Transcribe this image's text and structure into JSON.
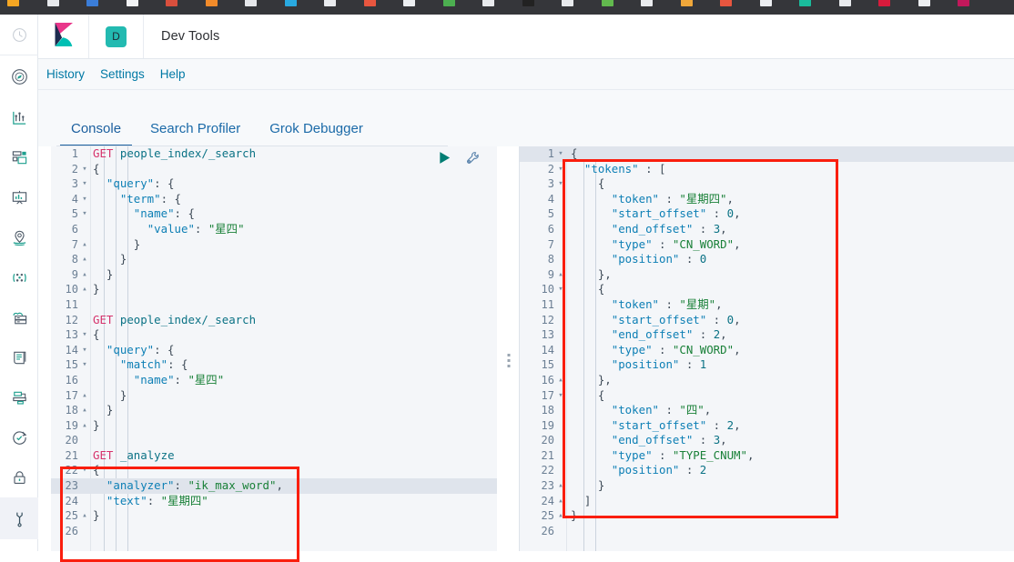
{
  "browser": {
    "bookmark_favicons": [
      "#f5a623",
      "#e8eaed",
      "#3b7dd8",
      "#f2f3f5",
      "#d94f3d",
      "#f28b2a",
      "#e5e7ea",
      "#29a9e0",
      "#e9ebee",
      "#e8563f",
      "#eceef1",
      "#4caf50",
      "#e8eaed",
      "#222222",
      "#e8eaed",
      "#62b94e",
      "#e9ebee",
      "#f0a73a",
      "#e8563f",
      "#eceef1",
      "#1abc9c",
      "#e8eaed",
      "#d81b3c",
      "#eceef1",
      "#c2185b"
    ]
  },
  "global_nav": {
    "items": [
      {
        "name": "recently-viewed",
        "icon": "clock-icon"
      },
      {
        "name": "discover",
        "icon": "compass-icon"
      },
      {
        "name": "visualize",
        "icon": "chart-icon"
      },
      {
        "name": "dashboard",
        "icon": "dashboard-icon"
      },
      {
        "name": "canvas",
        "icon": "presentation-icon"
      },
      {
        "name": "maps",
        "icon": "map-marker-icon"
      },
      {
        "name": "machine-learning",
        "icon": "ml-nodes-icon"
      },
      {
        "name": "infrastructure",
        "icon": "server-cloud-icon"
      },
      {
        "name": "logs",
        "icon": "logs-scroll-icon"
      },
      {
        "name": "apm",
        "icon": "apm-trace-icon"
      },
      {
        "name": "uptime",
        "icon": "uptime-clock-icon"
      },
      {
        "name": "security",
        "icon": "lock-icon"
      },
      {
        "name": "dev-tools",
        "icon": "wrench-icon"
      }
    ]
  },
  "header": {
    "logo": "kibana-logo",
    "space_badge": "D",
    "title": "Dev Tools"
  },
  "nav_links": [
    {
      "label": "History",
      "name": "history-link"
    },
    {
      "label": "Settings",
      "name": "settings-link"
    },
    {
      "label": "Help",
      "name": "help-link"
    }
  ],
  "tabs": [
    {
      "label": "Console",
      "active": true
    },
    {
      "label": "Search Profiler",
      "active": false
    },
    {
      "label": "Grok Debugger",
      "active": false
    }
  ],
  "editor_actions": [
    {
      "name": "send-request-button",
      "icon": "play-triangle-icon",
      "color": "#017d73"
    },
    {
      "name": "request-options-button",
      "icon": "wrench-icon",
      "color": "#5c85ad"
    }
  ],
  "colors": {
    "accent_blue": "#1b5f9e",
    "link_blue": "#0079a5",
    "teal": "#23bab1",
    "annotation_red": "#fa1e0e",
    "editor_bg": "#f4f6f9",
    "active_line": "#dfe4ec",
    "method": "#d6336c",
    "key": "#0d7fb5",
    "string": "#198038"
  },
  "request_editor": {
    "name": "console-request-editor",
    "active_line": 23,
    "lines": [
      {
        "n": 1,
        "fold": "",
        "tokens": [
          {
            "c": "t-method",
            "t": "GET"
          },
          {
            "c": "t-plain",
            "t": " "
          },
          {
            "c": "t-url",
            "t": "people_index/_search"
          }
        ]
      },
      {
        "n": 2,
        "fold": "▾",
        "tokens": [
          {
            "c": "t-punc",
            "t": "{"
          }
        ]
      },
      {
        "n": 3,
        "fold": "▾",
        "tokens": [
          {
            "c": "t-plain",
            "t": "  "
          },
          {
            "c": "t-key",
            "t": "\"query\""
          },
          {
            "c": "t-punc",
            "t": ": {"
          }
        ]
      },
      {
        "n": 4,
        "fold": "▾",
        "tokens": [
          {
            "c": "t-plain",
            "t": "    "
          },
          {
            "c": "t-key",
            "t": "\"term\""
          },
          {
            "c": "t-punc",
            "t": ": {"
          }
        ]
      },
      {
        "n": 5,
        "fold": "▾",
        "tokens": [
          {
            "c": "t-plain",
            "t": "      "
          },
          {
            "c": "t-key",
            "t": "\"name\""
          },
          {
            "c": "t-punc",
            "t": ": {"
          }
        ]
      },
      {
        "n": 6,
        "fold": "",
        "tokens": [
          {
            "c": "t-plain",
            "t": "        "
          },
          {
            "c": "t-key",
            "t": "\"value\""
          },
          {
            "c": "t-punc",
            "t": ": "
          },
          {
            "c": "t-str",
            "t": "\"星四\""
          }
        ]
      },
      {
        "n": 7,
        "fold": "▴",
        "tokens": [
          {
            "c": "t-plain",
            "t": "      "
          },
          {
            "c": "t-punc",
            "t": "}"
          }
        ]
      },
      {
        "n": 8,
        "fold": "▴",
        "tokens": [
          {
            "c": "t-plain",
            "t": "    "
          },
          {
            "c": "t-punc",
            "t": "}"
          }
        ]
      },
      {
        "n": 9,
        "fold": "▴",
        "tokens": [
          {
            "c": "t-plain",
            "t": "  "
          },
          {
            "c": "t-punc",
            "t": "}"
          }
        ]
      },
      {
        "n": 10,
        "fold": "▴",
        "tokens": [
          {
            "c": "t-punc",
            "t": "}"
          }
        ]
      },
      {
        "n": 11,
        "fold": "",
        "tokens": []
      },
      {
        "n": 12,
        "fold": "",
        "tokens": [
          {
            "c": "t-method",
            "t": "GET"
          },
          {
            "c": "t-plain",
            "t": " "
          },
          {
            "c": "t-url",
            "t": "people_index/_search"
          }
        ]
      },
      {
        "n": 13,
        "fold": "▾",
        "tokens": [
          {
            "c": "t-punc",
            "t": "{"
          }
        ]
      },
      {
        "n": 14,
        "fold": "▾",
        "tokens": [
          {
            "c": "t-plain",
            "t": "  "
          },
          {
            "c": "t-key",
            "t": "\"query\""
          },
          {
            "c": "t-punc",
            "t": ": {"
          }
        ]
      },
      {
        "n": 15,
        "fold": "▾",
        "tokens": [
          {
            "c": "t-plain",
            "t": "    "
          },
          {
            "c": "t-key",
            "t": "\"match\""
          },
          {
            "c": "t-punc",
            "t": ": {"
          }
        ]
      },
      {
        "n": 16,
        "fold": "",
        "tokens": [
          {
            "c": "t-plain",
            "t": "      "
          },
          {
            "c": "t-key",
            "t": "\"name\""
          },
          {
            "c": "t-punc",
            "t": ": "
          },
          {
            "c": "t-str",
            "t": "\"星四\""
          }
        ]
      },
      {
        "n": 17,
        "fold": "▴",
        "tokens": [
          {
            "c": "t-plain",
            "t": "    "
          },
          {
            "c": "t-punc",
            "t": "}"
          }
        ]
      },
      {
        "n": 18,
        "fold": "▴",
        "tokens": [
          {
            "c": "t-plain",
            "t": "  "
          },
          {
            "c": "t-punc",
            "t": "}"
          }
        ]
      },
      {
        "n": 19,
        "fold": "▴",
        "tokens": [
          {
            "c": "t-punc",
            "t": "}"
          }
        ]
      },
      {
        "n": 20,
        "fold": "",
        "tokens": []
      },
      {
        "n": 21,
        "fold": "",
        "tokens": [
          {
            "c": "t-method",
            "t": "GET"
          },
          {
            "c": "t-plain",
            "t": " "
          },
          {
            "c": "t-url",
            "t": "_analyze"
          }
        ]
      },
      {
        "n": 22,
        "fold": "▾",
        "tokens": [
          {
            "c": "t-punc",
            "t": "{"
          }
        ]
      },
      {
        "n": 23,
        "fold": "",
        "tokens": [
          {
            "c": "t-plain",
            "t": "  "
          },
          {
            "c": "t-key",
            "t": "\"analyzer\""
          },
          {
            "c": "t-punc",
            "t": ": "
          },
          {
            "c": "t-str",
            "t": "\"ik_max_word\""
          },
          {
            "c": "t-punc",
            "t": ","
          }
        ]
      },
      {
        "n": 24,
        "fold": "",
        "tokens": [
          {
            "c": "t-plain",
            "t": "  "
          },
          {
            "c": "t-key",
            "t": "\"text\""
          },
          {
            "c": "t-punc",
            "t": ": "
          },
          {
            "c": "t-str",
            "t": "\"星期四\""
          }
        ]
      },
      {
        "n": 25,
        "fold": "▴",
        "tokens": [
          {
            "c": "t-punc",
            "t": "}"
          }
        ]
      },
      {
        "n": 26,
        "fold": "",
        "tokens": []
      }
    ]
  },
  "response_editor": {
    "name": "console-response-editor",
    "active_line": 1,
    "lines": [
      {
        "n": 1,
        "fold": "▾",
        "tokens": [
          {
            "c": "t-punc",
            "t": "{"
          }
        ]
      },
      {
        "n": 2,
        "fold": "▾",
        "tokens": [
          {
            "c": "t-plain",
            "t": "  "
          },
          {
            "c": "t-key",
            "t": "\"tokens\""
          },
          {
            "c": "t-punc",
            "t": " : ["
          }
        ]
      },
      {
        "n": 3,
        "fold": "▾",
        "tokens": [
          {
            "c": "t-plain",
            "t": "    "
          },
          {
            "c": "t-punc",
            "t": "{"
          }
        ]
      },
      {
        "n": 4,
        "fold": "",
        "tokens": [
          {
            "c": "t-plain",
            "t": "      "
          },
          {
            "c": "t-key",
            "t": "\"token\""
          },
          {
            "c": "t-punc",
            "t": " : "
          },
          {
            "c": "t-str",
            "t": "\"星期四\""
          },
          {
            "c": "t-punc",
            "t": ","
          }
        ]
      },
      {
        "n": 5,
        "fold": "",
        "tokens": [
          {
            "c": "t-plain",
            "t": "      "
          },
          {
            "c": "t-key",
            "t": "\"start_offset\""
          },
          {
            "c": "t-punc",
            "t": " : "
          },
          {
            "c": "t-num",
            "t": "0"
          },
          {
            "c": "t-punc",
            "t": ","
          }
        ]
      },
      {
        "n": 6,
        "fold": "",
        "tokens": [
          {
            "c": "t-plain",
            "t": "      "
          },
          {
            "c": "t-key",
            "t": "\"end_offset\""
          },
          {
            "c": "t-punc",
            "t": " : "
          },
          {
            "c": "t-num",
            "t": "3"
          },
          {
            "c": "t-punc",
            "t": ","
          }
        ]
      },
      {
        "n": 7,
        "fold": "",
        "tokens": [
          {
            "c": "t-plain",
            "t": "      "
          },
          {
            "c": "t-key",
            "t": "\"type\""
          },
          {
            "c": "t-punc",
            "t": " : "
          },
          {
            "c": "t-str",
            "t": "\"CN_WORD\""
          },
          {
            "c": "t-punc",
            "t": ","
          }
        ]
      },
      {
        "n": 8,
        "fold": "",
        "tokens": [
          {
            "c": "t-plain",
            "t": "      "
          },
          {
            "c": "t-key",
            "t": "\"position\""
          },
          {
            "c": "t-punc",
            "t": " : "
          },
          {
            "c": "t-num",
            "t": "0"
          }
        ]
      },
      {
        "n": 9,
        "fold": "▴",
        "tokens": [
          {
            "c": "t-plain",
            "t": "    "
          },
          {
            "c": "t-punc",
            "t": "},"
          }
        ]
      },
      {
        "n": 10,
        "fold": "▾",
        "tokens": [
          {
            "c": "t-plain",
            "t": "    "
          },
          {
            "c": "t-punc",
            "t": "{"
          }
        ]
      },
      {
        "n": 11,
        "fold": "",
        "tokens": [
          {
            "c": "t-plain",
            "t": "      "
          },
          {
            "c": "t-key",
            "t": "\"token\""
          },
          {
            "c": "t-punc",
            "t": " : "
          },
          {
            "c": "t-str",
            "t": "\"星期\""
          },
          {
            "c": "t-punc",
            "t": ","
          }
        ]
      },
      {
        "n": 12,
        "fold": "",
        "tokens": [
          {
            "c": "t-plain",
            "t": "      "
          },
          {
            "c": "t-key",
            "t": "\"start_offset\""
          },
          {
            "c": "t-punc",
            "t": " : "
          },
          {
            "c": "t-num",
            "t": "0"
          },
          {
            "c": "t-punc",
            "t": ","
          }
        ]
      },
      {
        "n": 13,
        "fold": "",
        "tokens": [
          {
            "c": "t-plain",
            "t": "      "
          },
          {
            "c": "t-key",
            "t": "\"end_offset\""
          },
          {
            "c": "t-punc",
            "t": " : "
          },
          {
            "c": "t-num",
            "t": "2"
          },
          {
            "c": "t-punc",
            "t": ","
          }
        ]
      },
      {
        "n": 14,
        "fold": "",
        "tokens": [
          {
            "c": "t-plain",
            "t": "      "
          },
          {
            "c": "t-key",
            "t": "\"type\""
          },
          {
            "c": "t-punc",
            "t": " : "
          },
          {
            "c": "t-str",
            "t": "\"CN_WORD\""
          },
          {
            "c": "t-punc",
            "t": ","
          }
        ]
      },
      {
        "n": 15,
        "fold": "",
        "tokens": [
          {
            "c": "t-plain",
            "t": "      "
          },
          {
            "c": "t-key",
            "t": "\"position\""
          },
          {
            "c": "t-punc",
            "t": " : "
          },
          {
            "c": "t-num",
            "t": "1"
          }
        ]
      },
      {
        "n": 16,
        "fold": "▴",
        "tokens": [
          {
            "c": "t-plain",
            "t": "    "
          },
          {
            "c": "t-punc",
            "t": "},"
          }
        ]
      },
      {
        "n": 17,
        "fold": "▾",
        "tokens": [
          {
            "c": "t-plain",
            "t": "    "
          },
          {
            "c": "t-punc",
            "t": "{"
          }
        ]
      },
      {
        "n": 18,
        "fold": "",
        "tokens": [
          {
            "c": "t-plain",
            "t": "      "
          },
          {
            "c": "t-key",
            "t": "\"token\""
          },
          {
            "c": "t-punc",
            "t": " : "
          },
          {
            "c": "t-str",
            "t": "\"四\""
          },
          {
            "c": "t-punc",
            "t": ","
          }
        ]
      },
      {
        "n": 19,
        "fold": "",
        "tokens": [
          {
            "c": "t-plain",
            "t": "      "
          },
          {
            "c": "t-key",
            "t": "\"start_offset\""
          },
          {
            "c": "t-punc",
            "t": " : "
          },
          {
            "c": "t-num",
            "t": "2"
          },
          {
            "c": "t-punc",
            "t": ","
          }
        ]
      },
      {
        "n": 20,
        "fold": "",
        "tokens": [
          {
            "c": "t-plain",
            "t": "      "
          },
          {
            "c": "t-key",
            "t": "\"end_offset\""
          },
          {
            "c": "t-punc",
            "t": " : "
          },
          {
            "c": "t-num",
            "t": "3"
          },
          {
            "c": "t-punc",
            "t": ","
          }
        ]
      },
      {
        "n": 21,
        "fold": "",
        "tokens": [
          {
            "c": "t-plain",
            "t": "      "
          },
          {
            "c": "t-key",
            "t": "\"type\""
          },
          {
            "c": "t-punc",
            "t": " : "
          },
          {
            "c": "t-str",
            "t": "\"TYPE_CNUM\""
          },
          {
            "c": "t-punc",
            "t": ","
          }
        ]
      },
      {
        "n": 22,
        "fold": "",
        "tokens": [
          {
            "c": "t-plain",
            "t": "      "
          },
          {
            "c": "t-key",
            "t": "\"position\""
          },
          {
            "c": "t-punc",
            "t": " : "
          },
          {
            "c": "t-num",
            "t": "2"
          }
        ]
      },
      {
        "n": 23,
        "fold": "▴",
        "tokens": [
          {
            "c": "t-plain",
            "t": "    "
          },
          {
            "c": "t-punc",
            "t": "}"
          }
        ]
      },
      {
        "n": 24,
        "fold": "▴",
        "tokens": [
          {
            "c": "t-plain",
            "t": "  "
          },
          {
            "c": "t-punc",
            "t": "]"
          }
        ]
      },
      {
        "n": 25,
        "fold": "▴",
        "tokens": [
          {
            "c": "t-punc",
            "t": "}"
          }
        ]
      },
      {
        "n": 26,
        "fold": "",
        "tokens": []
      }
    ]
  },
  "annotations": [
    {
      "name": "annotation-box-request",
      "target": "analyze-request"
    },
    {
      "name": "annotation-box-response",
      "target": "tokens-array"
    }
  ]
}
